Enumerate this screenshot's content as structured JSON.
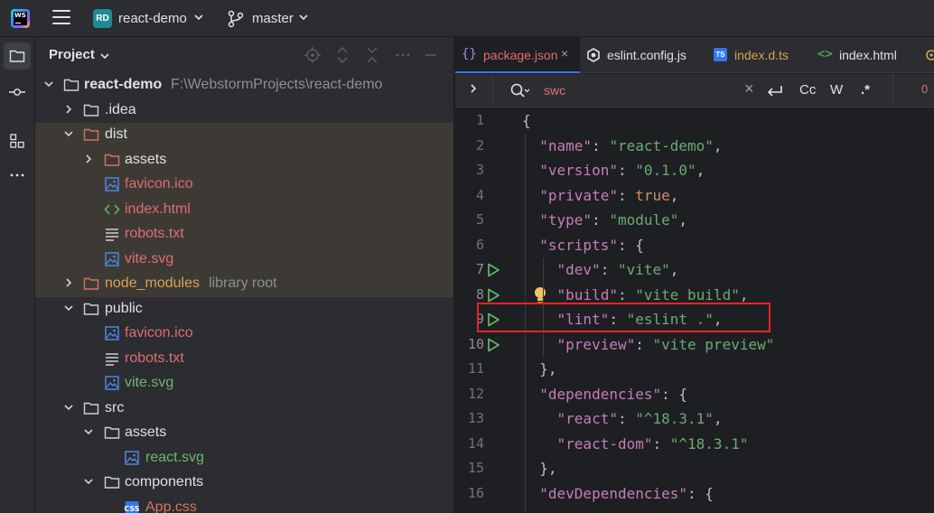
{
  "titlebar": {
    "logo_text": "WS",
    "project_badge": "RD",
    "project_name": "react-demo",
    "branch": "master"
  },
  "project_panel": {
    "title": "Project",
    "tree": [
      {
        "label": "react-demo",
        "hint": "F:\\WebstormProjects\\react-demo",
        "type": "folder",
        "expanded": true
      },
      {
        "label": ".idea",
        "type": "folder",
        "expanded": false
      },
      {
        "label": "dist",
        "type": "folder",
        "expanded": true
      },
      {
        "label": "assets",
        "type": "folder",
        "expanded": false
      },
      {
        "label": "favicon.ico",
        "type": "image"
      },
      {
        "label": "index.html",
        "type": "html"
      },
      {
        "label": "robots.txt",
        "type": "text"
      },
      {
        "label": "vite.svg",
        "type": "image"
      },
      {
        "label": "node_modules",
        "hint": "library root",
        "type": "folder",
        "expanded": false
      },
      {
        "label": "public",
        "type": "folder",
        "expanded": true
      },
      {
        "label": "favicon.ico",
        "type": "image"
      },
      {
        "label": "robots.txt",
        "type": "text"
      },
      {
        "label": "vite.svg",
        "type": "image"
      },
      {
        "label": "src",
        "type": "folder",
        "expanded": true
      },
      {
        "label": "assets",
        "type": "folder",
        "expanded": true
      },
      {
        "label": "react.svg",
        "type": "image"
      },
      {
        "label": "components",
        "type": "folder",
        "expanded": true
      },
      {
        "label": "App.css",
        "type": "css"
      }
    ]
  },
  "tabs": [
    {
      "label": "package.json",
      "icon": "{}",
      "active": true,
      "close": "×"
    },
    {
      "label": "eslint.config.js",
      "icon": "eslint-icon",
      "active": false
    },
    {
      "label": "index.d.ts",
      "icon": "TS",
      "active": false
    },
    {
      "label": "index.html",
      "icon": "<>",
      "active": false
    }
  ],
  "find": {
    "query": "swc",
    "clear": "×",
    "opt_case": "Cc",
    "opt_word": "W",
    "opt_regex": ".*",
    "count": "0"
  },
  "code": {
    "lines": [
      {
        "n": "1",
        "parts": [
          {
            "c": "p",
            "t": "{"
          }
        ]
      },
      {
        "n": "2",
        "parts": [
          {
            "c": "p",
            "t": "  "
          },
          {
            "c": "k",
            "t": "\"name\""
          },
          {
            "c": "p",
            "t": ": "
          },
          {
            "c": "s",
            "t": "\"react-demo\""
          },
          {
            "c": "p",
            "t": ","
          }
        ]
      },
      {
        "n": "3",
        "parts": [
          {
            "c": "p",
            "t": "  "
          },
          {
            "c": "k",
            "t": "\"version\""
          },
          {
            "c": "p",
            "t": ": "
          },
          {
            "c": "s",
            "t": "\"0.1.0\""
          },
          {
            "c": "p",
            "t": ","
          }
        ]
      },
      {
        "n": "4",
        "parts": [
          {
            "c": "p",
            "t": "  "
          },
          {
            "c": "k",
            "t": "\"private\""
          },
          {
            "c": "p",
            "t": ": "
          },
          {
            "c": "kw",
            "t": "true"
          },
          {
            "c": "p",
            "t": ","
          }
        ]
      },
      {
        "n": "5",
        "parts": [
          {
            "c": "p",
            "t": "  "
          },
          {
            "c": "k",
            "t": "\"type\""
          },
          {
            "c": "p",
            "t": ": "
          },
          {
            "c": "s",
            "t": "\"module\""
          },
          {
            "c": "p",
            "t": ","
          }
        ]
      },
      {
        "n": "6",
        "parts": [
          {
            "c": "p",
            "t": "  "
          },
          {
            "c": "k",
            "t": "\"scripts\""
          },
          {
            "c": "p",
            "t": ": {"
          }
        ]
      },
      {
        "n": "7",
        "run": true,
        "parts": [
          {
            "c": "p",
            "t": "    "
          },
          {
            "c": "k",
            "t": "\"dev\""
          },
          {
            "c": "p",
            "t": ": "
          },
          {
            "c": "s",
            "t": "\"vite\""
          },
          {
            "c": "p",
            "t": ","
          }
        ]
      },
      {
        "n": "8",
        "run": true,
        "bulb": true,
        "parts": [
          {
            "c": "p",
            "t": "    "
          },
          {
            "c": "k",
            "t": "\"build\""
          },
          {
            "c": "p",
            "t": ": "
          },
          {
            "c": "s",
            "t": "\"vite build\""
          },
          {
            "c": "p",
            "t": ","
          }
        ]
      },
      {
        "n": "9",
        "run": true,
        "parts": [
          {
            "c": "p",
            "t": "    "
          },
          {
            "c": "k",
            "t": "\"lint\""
          },
          {
            "c": "p",
            "t": ": "
          },
          {
            "c": "s",
            "t": "\"eslint .\""
          },
          {
            "c": "p",
            "t": ","
          }
        ]
      },
      {
        "n": "10",
        "run": true,
        "parts": [
          {
            "c": "p",
            "t": "    "
          },
          {
            "c": "k",
            "t": "\"preview\""
          },
          {
            "c": "p",
            "t": ": "
          },
          {
            "c": "s",
            "t": "\"vite preview\""
          }
        ]
      },
      {
        "n": "11",
        "parts": [
          {
            "c": "p",
            "t": "  },"
          }
        ]
      },
      {
        "n": "12",
        "parts": [
          {
            "c": "p",
            "t": "  "
          },
          {
            "c": "k",
            "t": "\"dependencies\""
          },
          {
            "c": "p",
            "t": ": {"
          }
        ]
      },
      {
        "n": "13",
        "parts": [
          {
            "c": "p",
            "t": "    "
          },
          {
            "c": "k",
            "t": "\"react\""
          },
          {
            "c": "p",
            "t": ": "
          },
          {
            "c": "s",
            "t": "\"^18.3.1\""
          },
          {
            "c": "p",
            "t": ","
          }
        ]
      },
      {
        "n": "14",
        "parts": [
          {
            "c": "p",
            "t": "    "
          },
          {
            "c": "k",
            "t": "\"react-dom\""
          },
          {
            "c": "p",
            "t": ": "
          },
          {
            "c": "s",
            "t": "\"^18.3.1\""
          }
        ]
      },
      {
        "n": "15",
        "parts": [
          {
            "c": "p",
            "t": "  },"
          }
        ]
      },
      {
        "n": "16",
        "parts": [
          {
            "c": "p",
            "t": "  "
          },
          {
            "c": "k",
            "t": "\"devDependencies\""
          },
          {
            "c": "p",
            "t": ": {"
          }
        ]
      }
    ]
  },
  "colors": {
    "accent": "#3574f0",
    "highlight_box": "#e8232a",
    "run_icon": "#5fb865"
  }
}
